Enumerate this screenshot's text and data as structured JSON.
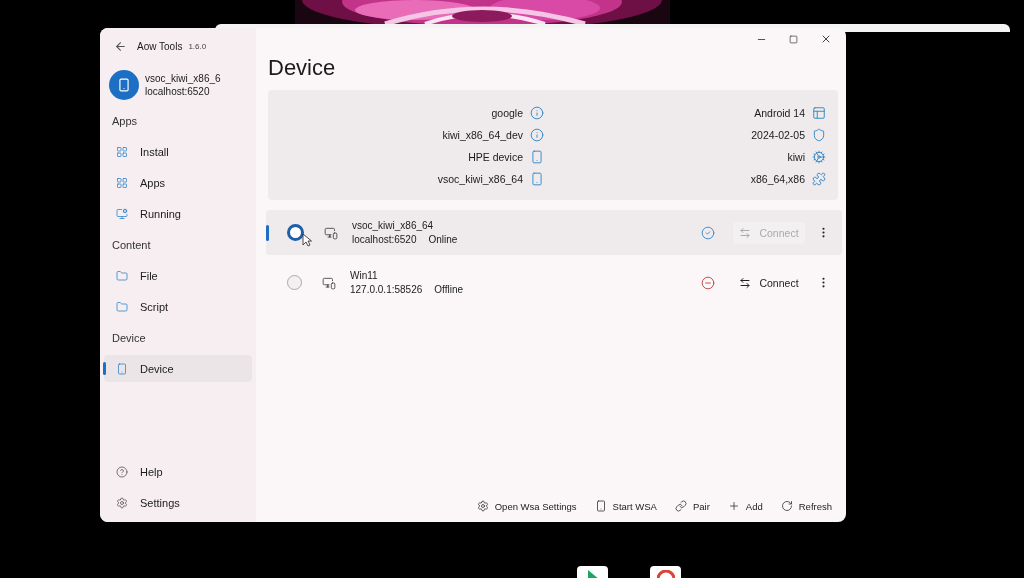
{
  "app": {
    "title": "Aow Tools",
    "version": "1.6.0"
  },
  "current_device": {
    "name": "vsoc_kiwi_x86_6",
    "address": "localhost:6520"
  },
  "nav": [
    {
      "section": "Apps",
      "items": [
        {
          "label": "Install",
          "kind": "grid",
          "selected": false
        },
        {
          "label": "Apps",
          "kind": "grid",
          "selected": false
        },
        {
          "label": "Running",
          "kind": "monitor",
          "selected": false
        }
      ]
    },
    {
      "section": "Content",
      "items": [
        {
          "label": "File",
          "kind": "folder",
          "selected": false
        },
        {
          "label": "Script",
          "kind": "folder",
          "selected": false
        }
      ]
    },
    {
      "section": "Device",
      "items": [
        {
          "label": "Device",
          "kind": "phone",
          "selected": true
        }
      ]
    }
  ],
  "footer_nav": [
    {
      "label": "Help",
      "kind": "help",
      "selected": false
    },
    {
      "label": "Settings",
      "kind": "settings",
      "selected": false
    }
  ],
  "page_title": "Device",
  "info": {
    "left": [
      {
        "value": "google",
        "kind": "info"
      },
      {
        "value": "kiwi_x86_64_dev",
        "kind": "info"
      },
      {
        "value": "HPE device",
        "kind": "phone"
      },
      {
        "value": "vsoc_kiwi_x86_64",
        "kind": "phone"
      }
    ],
    "right": [
      {
        "value": "Android 14",
        "kind": "panel"
      },
      {
        "value": "2024-02-05",
        "kind": "shield"
      },
      {
        "value": "kiwi",
        "kind": "cog"
      },
      {
        "value": "x86_64,x86",
        "kind": "puzzle"
      }
    ]
  },
  "devices": [
    {
      "name": "vsoc_kiwi_x86_64",
      "address": "localhost:6520",
      "status": "Online",
      "online": true,
      "selected": true,
      "connect": {
        "label": "Connect",
        "disabled": true
      }
    },
    {
      "name": "Win11",
      "address": "127.0.0.1:58526",
      "status": "Offline",
      "online": false,
      "selected": false,
      "connect": {
        "label": "Connect",
        "disabled": false
      }
    }
  ],
  "actions": [
    {
      "label": "Open Wsa Settings",
      "kind": "settings"
    },
    {
      "label": "Start WSA",
      "kind": "phone"
    },
    {
      "label": "Pair",
      "kind": "link"
    },
    {
      "label": "Add",
      "kind": "plus"
    },
    {
      "label": "Refresh",
      "kind": "refresh"
    }
  ]
}
